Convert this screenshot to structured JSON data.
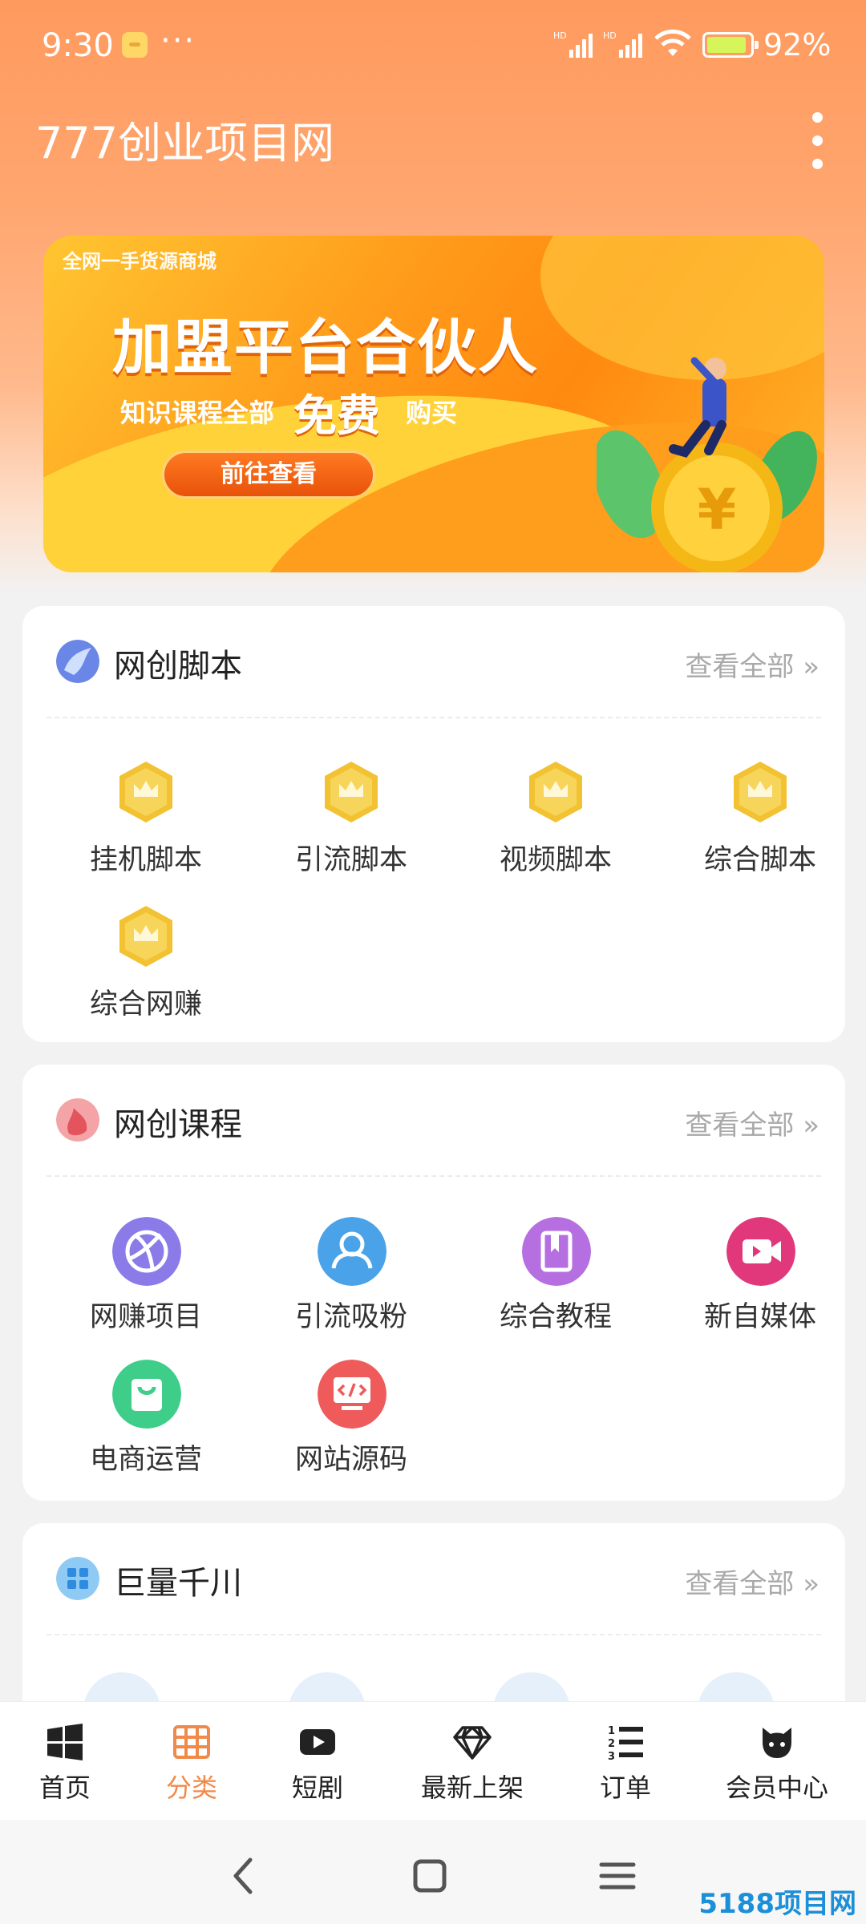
{
  "status_bar": {
    "time": "9:30",
    "dots": "···",
    "battery_pct": "92%",
    "battery_level": 0.92
  },
  "app_bar": {
    "title": "777创业项目网"
  },
  "banner": {
    "small_text": "全网一手货源商城",
    "title": "加盟平台合伙人",
    "sub_before": "知识课程全部",
    "sub_highlight": "免费",
    "sub_after": "购买",
    "button": "前往查看"
  },
  "sections": [
    {
      "title": "网创脚本",
      "more": "查看全部 »",
      "icon": "blue-swirl-icon",
      "items": [
        {
          "label": "挂机脚本",
          "icon": "crown-badge-icon"
        },
        {
          "label": "引流脚本",
          "icon": "crown-badge-icon"
        },
        {
          "label": "视频脚本",
          "icon": "crown-badge-icon"
        },
        {
          "label": "综合脚本",
          "icon": "crown-badge-icon"
        },
        {
          "label": "综合网赚",
          "icon": "crown-badge-icon"
        }
      ]
    },
    {
      "title": "网创课程",
      "more": "查看全部 »",
      "icon": "red-flame-icon",
      "items": [
        {
          "label": "网赚项目",
          "icon": "globe-icon",
          "color": "#8b7be8"
        },
        {
          "label": "引流吸粉",
          "icon": "user-icon",
          "color": "#4aa3e8"
        },
        {
          "label": "综合教程",
          "icon": "book-icon",
          "color": "#b66fe0"
        },
        {
          "label": "新自媒体",
          "icon": "video-icon",
          "color": "#e0387a"
        },
        {
          "label": "电商运营",
          "icon": "shopping-bag-icon",
          "color": "#3fce8a"
        },
        {
          "label": "网站源码",
          "icon": "code-monitor-icon",
          "color": "#ef5a5a"
        }
      ]
    },
    {
      "title": "巨量千川",
      "more": "查看全部 »",
      "icon": "grid-app-icon"
    }
  ],
  "tab_bar": [
    {
      "label": "首页",
      "icon": "windows-icon",
      "active": false
    },
    {
      "label": "分类",
      "icon": "grid-table-icon",
      "active": true
    },
    {
      "label": "短剧",
      "icon": "play-icon",
      "active": false
    },
    {
      "label": "最新上架",
      "icon": "diamond-icon",
      "active": false
    },
    {
      "label": "订单",
      "icon": "numbered-list-icon",
      "active": false
    },
    {
      "label": "会员中心",
      "icon": "cat-icon",
      "active": false
    }
  ],
  "colors": {
    "accent": "#f08a4a",
    "header": "#ff9a5e",
    "crown_gold": "#f2c232"
  },
  "watermark": "5188项目网"
}
